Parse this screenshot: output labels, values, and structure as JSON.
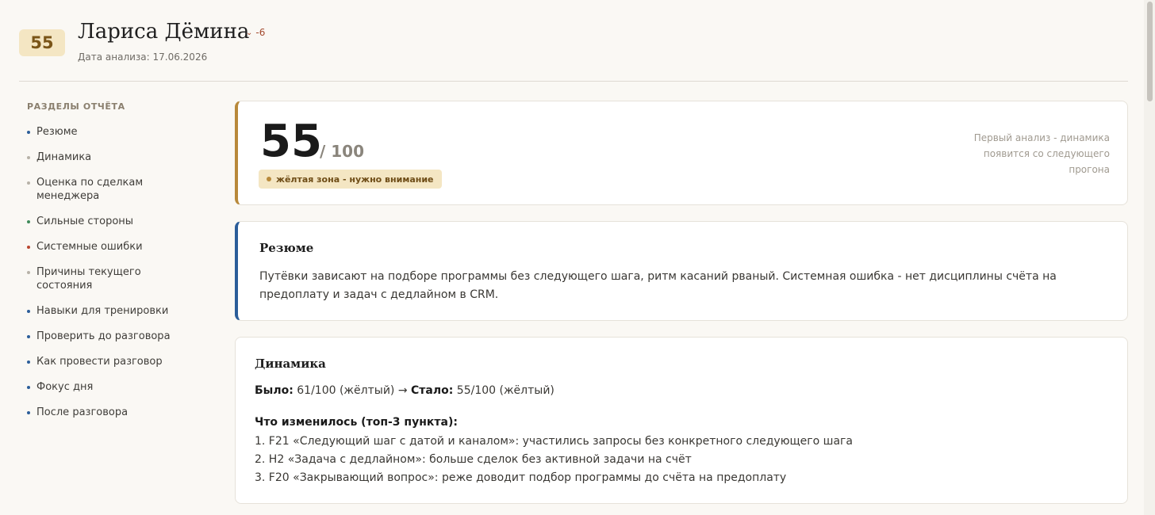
{
  "header": {
    "score": "55",
    "name": "Лариса Дёмина",
    "delta": "-6",
    "analysis_date": "Дата анализа: 17.06.2026"
  },
  "sidebar": {
    "title": "РАЗДЕЛЫ ОТЧЁТА",
    "items": [
      {
        "label": "Резюме",
        "dot_color": "#2b5d99"
      },
      {
        "label": "Динамика",
        "dot_color": "#b7b2a8"
      },
      {
        "label": "Оценка по сделкам менеджера",
        "dot_color": "#b7b2a8"
      },
      {
        "label": "Сильные стороны",
        "dot_color": "#3f8a5a"
      },
      {
        "label": "Системные ошибки",
        "dot_color": "#b9462f"
      },
      {
        "label": "Причины текущего состояния",
        "dot_color": "#b7b2a8"
      },
      {
        "label": "Навыки для тренировки",
        "dot_color": "#2b5d99"
      },
      {
        "label": "Проверить до разговора",
        "dot_color": "#2b5d99"
      },
      {
        "label": "Как провести разговор",
        "dot_color": "#2b5d99"
      },
      {
        "label": "Фокус дня",
        "dot_color": "#2b5d99"
      },
      {
        "label": "После разговора",
        "dot_color": "#2b5d99"
      }
    ]
  },
  "score_card": {
    "score": "55",
    "out_of": "/ 100",
    "zone_label": "жёлтая зона - нужно внимание",
    "first_analysis_note": "Первый анализ - динамика появится со следующего прогона",
    "accent_color": "#b8893a"
  },
  "summary_card": {
    "title": "Резюме",
    "text": "Путёвки зависают на подборе программы без следующего шага, ритм касаний рваный. Системная ошибка - нет дисциплины счёта на предоплату и задач с дедлайном в CRM.",
    "accent_color": "#2b5d99"
  },
  "dynamics_card": {
    "title": "Динамика",
    "was_label": "Было:",
    "was_value": "61/100 (жёлтый)",
    "arrow": "→",
    "now_label": "Стало:",
    "now_value": "55/100 (жёлтый)",
    "changes_title": "Что изменилось (топ-3 пункта):",
    "changes": [
      "1. F21 «Следующий шаг с датой и каналом»: участились запросы без конкретного следующего шага",
      "2. H2 «Задача с дедлайном»: больше сделок без активной задачи на счёт",
      "3. F20 «Закрывающий вопрос»: реже доводит подбор программы до счёта на предоплату"
    ]
  }
}
